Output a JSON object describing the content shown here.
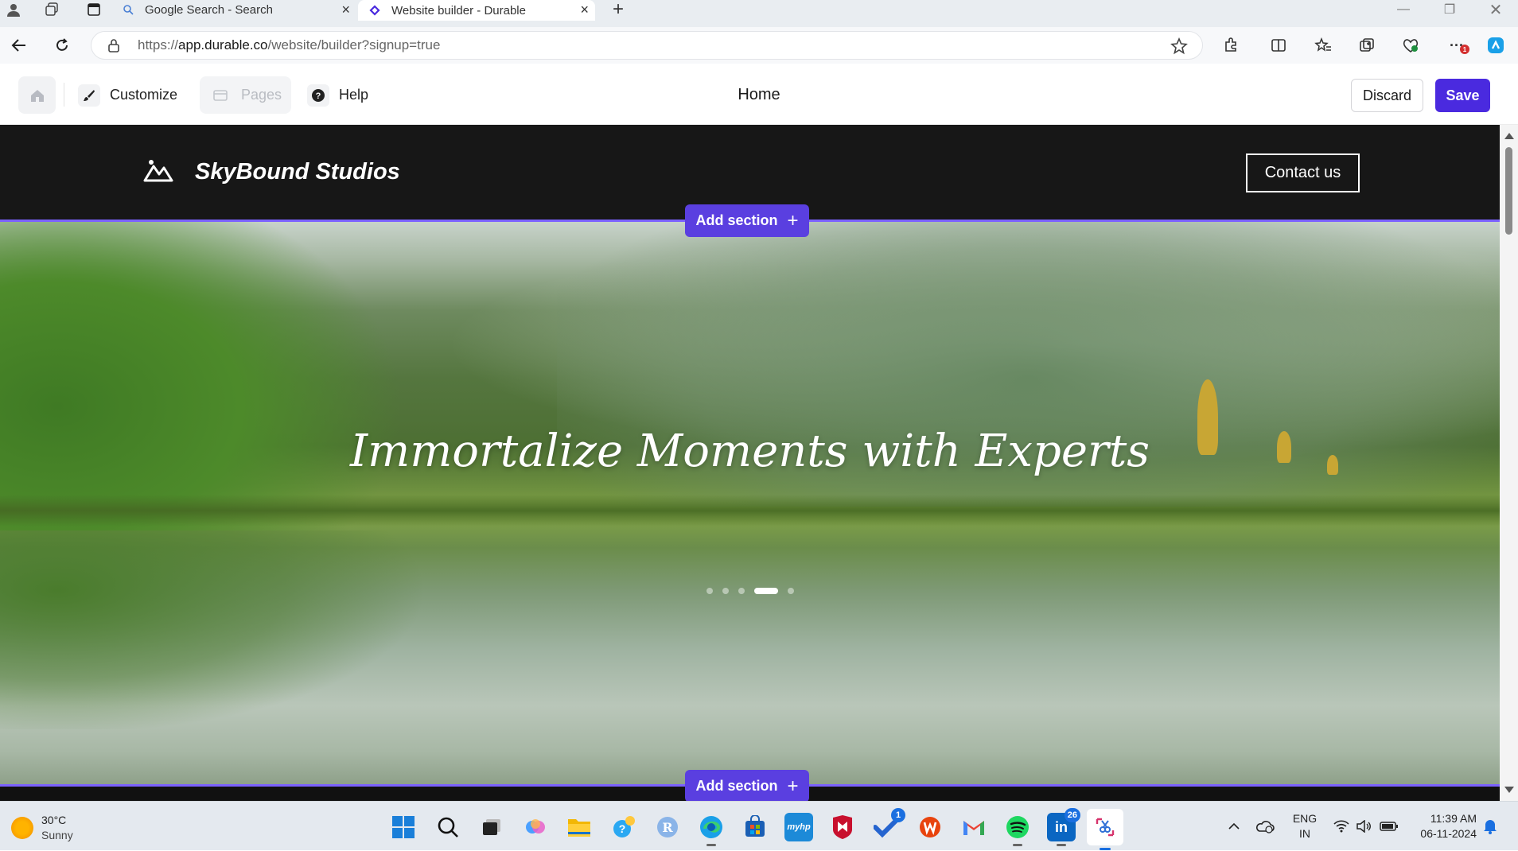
{
  "browser": {
    "tabs": [
      {
        "title": "Google Search - Search",
        "active": false
      },
      {
        "title": "Website builder - Durable",
        "active": true
      }
    ],
    "url_prefix": "https://",
    "url_host": "app.durable.co",
    "url_path": "/website/builder?signup=true"
  },
  "builder": {
    "customize_label": "Customize",
    "pages_label": "Pages",
    "help_label": "Help",
    "page_title": "Home",
    "discard_label": "Discard",
    "save_label": "Save",
    "accent_color": "#4a2adf"
  },
  "site": {
    "brand_name": "SkyBound Studios",
    "contact_label": "Contact us",
    "hero_title": "Immortalize Moments with Experts",
    "carousel": {
      "count": 5,
      "active_index": 3
    }
  },
  "add_section": {
    "label": "Add section"
  },
  "taskbar": {
    "weather_temp": "30°C",
    "weather_condition": "Sunny",
    "lang_line1": "ENG",
    "lang_line2": "IN",
    "time": "11:39 AM",
    "date": "06-11-2024",
    "edge_notifications": "1",
    "todo_badge": "1",
    "linkedin_badge": "26"
  }
}
